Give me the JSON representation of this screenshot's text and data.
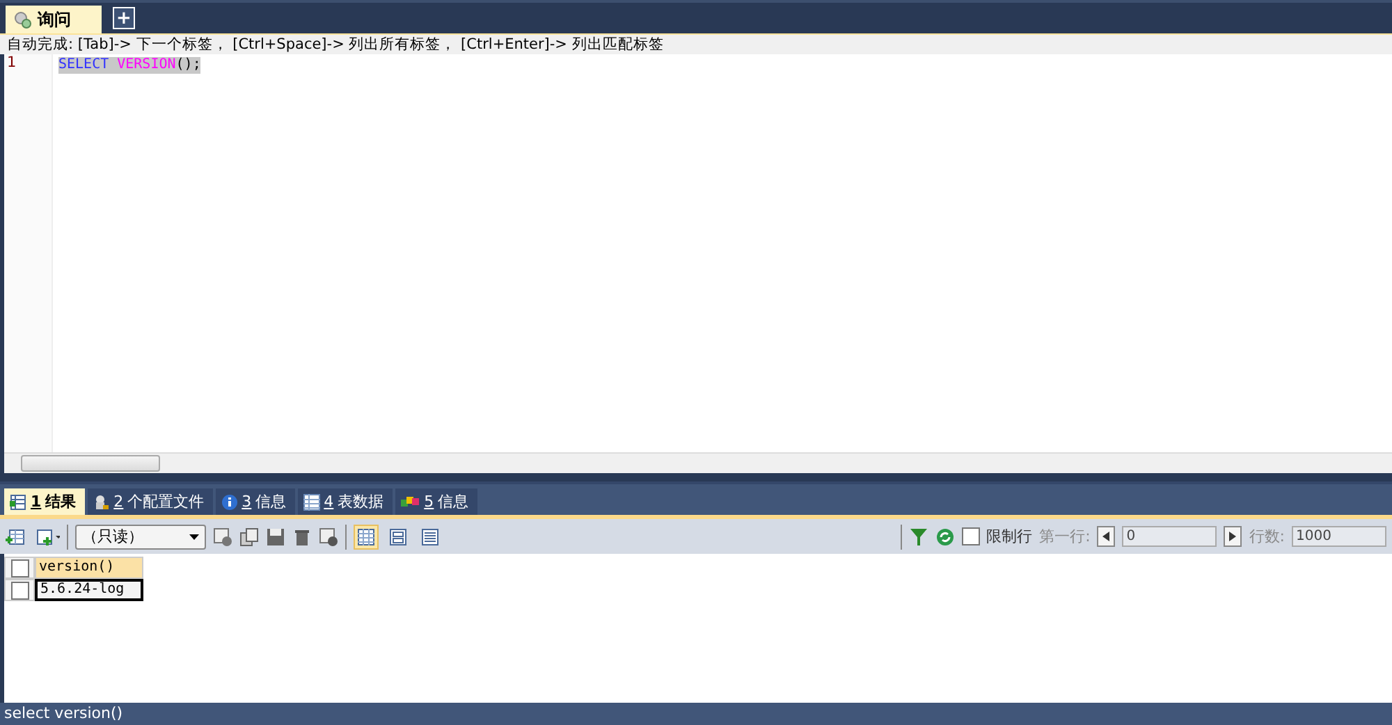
{
  "query_tabs": [
    {
      "label": "询问",
      "selected": true
    }
  ],
  "add_tab": {
    "label": "+"
  },
  "autocomplete_hint": "自动完成: [Tab]-> 下一个标签， [Ctrl+Space]-> 列出所有标签， [Ctrl+Enter]-> 列出匹配标签",
  "editor": {
    "lines": [
      {
        "number": "1",
        "selected": true,
        "tokens": [
          {
            "kind": "keyword",
            "text": "SELECT"
          },
          {
            "kind": "function",
            "text": "VERSION"
          },
          {
            "kind": "plain",
            "text": "();"
          }
        ]
      }
    ]
  },
  "result_tabs": [
    {
      "number": "1",
      "label": "结果",
      "kind": "result",
      "selected": true
    },
    {
      "number": "2",
      "label": "个配置文件",
      "kind": "profile",
      "selected": false
    },
    {
      "number": "3",
      "label": "信息",
      "kind": "info",
      "selected": false
    },
    {
      "number": "4",
      "label": "表数据",
      "kind": "table",
      "selected": false
    },
    {
      "number": "5",
      "label": "信息",
      "kind": "blocks",
      "selected": false
    }
  ],
  "toolbar": {
    "mode_select": {
      "value": "（只读）"
    },
    "view_modes": [
      {
        "kind": "grid",
        "selected": true
      },
      {
        "kind": "form",
        "selected": false
      },
      {
        "kind": "text",
        "selected": false
      }
    ],
    "limit_rows": {
      "label": "限制行",
      "checked": false
    },
    "first_row": {
      "label": "第一行:",
      "value": "0"
    },
    "row_count": {
      "label": "行数:",
      "value": "1000"
    }
  },
  "grid": {
    "columns": [
      "version()"
    ],
    "rows": [
      {
        "checked": false,
        "cells": [
          {
            "text": "5.6.24-log",
            "selected": true
          }
        ]
      }
    ]
  },
  "status_bar": "select version()"
}
